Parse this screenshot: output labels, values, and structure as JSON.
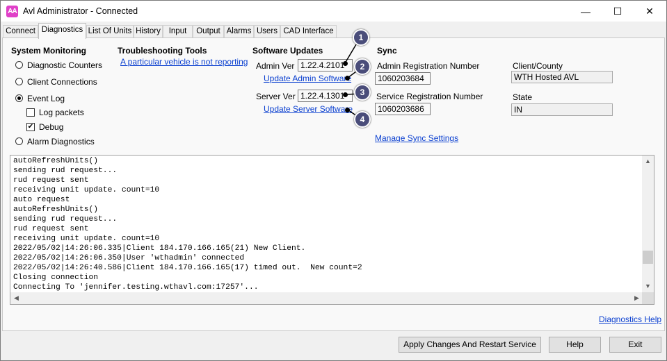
{
  "window": {
    "title": "Avl Administrator - Connected",
    "icon_text": "AA",
    "minimize_glyph": "—",
    "maximize_glyph": "☐",
    "close_glyph": "✕"
  },
  "tabs": [
    {
      "label": "Connect"
    },
    {
      "label": "Diagnostics"
    },
    {
      "label": "List Of Units"
    },
    {
      "label": "History"
    },
    {
      "label": "Input"
    },
    {
      "label": "Output"
    },
    {
      "label": "Alarms"
    },
    {
      "label": "Users"
    },
    {
      "label": "CAD Interface"
    }
  ],
  "active_tab": "Diagnostics",
  "system_monitoring": {
    "heading": "System Monitoring",
    "options": {
      "diagnostic_counters": "Diagnostic Counters",
      "client_connections": "Client Connections",
      "event_log": "Event Log",
      "alarm_diagnostics": "Alarm Diagnostics"
    },
    "selected": "Event Log",
    "log_packets": {
      "label": "Log packets",
      "checked": false
    },
    "debug": {
      "label": "Debug",
      "checked": true
    }
  },
  "troubleshooting": {
    "heading": "Troubleshooting Tools",
    "link": "A particular vehicle is not reporting"
  },
  "software_updates": {
    "heading": "Software Updates",
    "admin_ver_label": "Admin Ver",
    "admin_ver_value": "1.22.4.2101",
    "update_admin_link": "Update Admin Software",
    "server_ver_label": "Server Ver",
    "server_ver_value": "1.22.4.1301",
    "update_server_link": "Update Server Software"
  },
  "sync": {
    "heading": "Sync",
    "admin_reg_label": "Admin Registration Number",
    "admin_reg_value": "1060203684",
    "service_reg_label": "Service Registration Number",
    "service_reg_value": "1060203686",
    "manage_link": "Manage Sync Settings"
  },
  "client": {
    "county_label": "Client/County",
    "county_value": "WTH Hosted AVL",
    "state_label": "State",
    "state_value": "IN"
  },
  "callouts": [
    "1",
    "2",
    "3",
    "4"
  ],
  "log_lines": [
    "autoRefreshUnits()",
    "sending rud request...",
    "rud request sent",
    "receiving unit update. count=10",
    "auto request",
    "autoRefreshUnits()",
    "sending rud request...",
    "rud request sent",
    "receiving unit update. count=10",
    "2022/05/02|14:26:06.335|Client 184.170.166.165(21) New Client.",
    "2022/05/02|14:26:06.350|User 'wthadmin' connected",
    "2022/05/02|14:26:40.586|Client 184.170.166.165(17) timed out.  New count=2",
    "Closing connection",
    "Connecting To 'jennifer.testing.wthavl.com:17257'..."
  ],
  "diagnostics_help_link": "Diagnostics Help",
  "buttons": {
    "apply": "Apply Changes And Restart Service",
    "help": "Help",
    "exit": "Exit"
  },
  "icons": {
    "scroll_up": "chevron-up-icon",
    "scroll_down": "chevron-down-icon",
    "scroll_left": "chevron-left-icon",
    "scroll_right": "chevron-right-icon"
  },
  "colors": {
    "link": "#0a3fd0",
    "callout": "#4a4d7a",
    "app_icon": "#e040c8"
  }
}
